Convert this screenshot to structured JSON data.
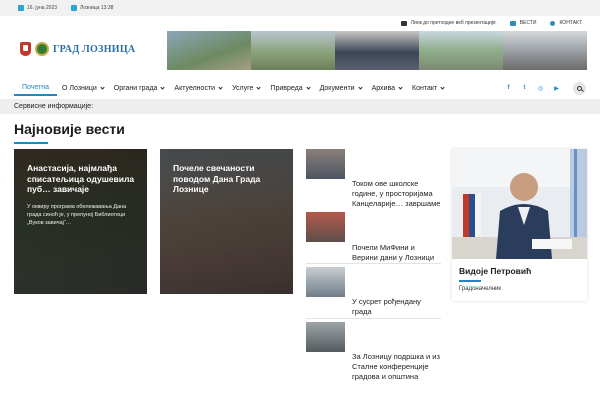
{
  "topbar": {
    "date": "16. јуна 2023",
    "weather": "Лозница 13:38"
  },
  "sublinks": {
    "prev_site": "Линк до претходне веб презентације",
    "news": "ВЕСТИ",
    "contact": "КОНТАКТ"
  },
  "header": {
    "logo_text": "ГРАД ЛОЗНИЦА"
  },
  "nav": {
    "items": [
      {
        "label": "Почетна"
      },
      {
        "label": "О Лозници"
      },
      {
        "label": "Органи града"
      },
      {
        "label": "Актуелности"
      },
      {
        "label": "Услуге"
      },
      {
        "label": "Привреда"
      },
      {
        "label": "Документи"
      },
      {
        "label": "Архива"
      },
      {
        "label": "Контакт"
      }
    ],
    "socials": [
      "f",
      "t",
      "◎",
      "▶"
    ]
  },
  "service": {
    "label": "Сервисне информације:"
  },
  "section": {
    "title": "Најновије вести"
  },
  "cards": [
    {
      "title": "Анастасија, најмлађа списатељица одушевила пуб… завичаје",
      "excerpt": "У оквиру програма обележавања Дана града синоћ је, у препуној Библиотеци „Вуков завичај“…"
    },
    {
      "title": "Почеле свечаности поводом Дана Града Лознице",
      "excerpt": ""
    }
  ],
  "news": [
    {
      "title": "Током ове школске године, у просторијама Канцеларије… завршаме"
    },
    {
      "title": "Почели МиФини и Верини дани у Лозници"
    },
    {
      "title": "У сусрет рођендану града"
    },
    {
      "title": "За Лозницу подршка и из Сталне конференције градова и општина"
    }
  ],
  "mayor": {
    "name": "Видоје Петровић",
    "role": "Градоначелник"
  },
  "colors": {
    "accent": "#1e88c7",
    "logo": "#2a6ea6"
  }
}
